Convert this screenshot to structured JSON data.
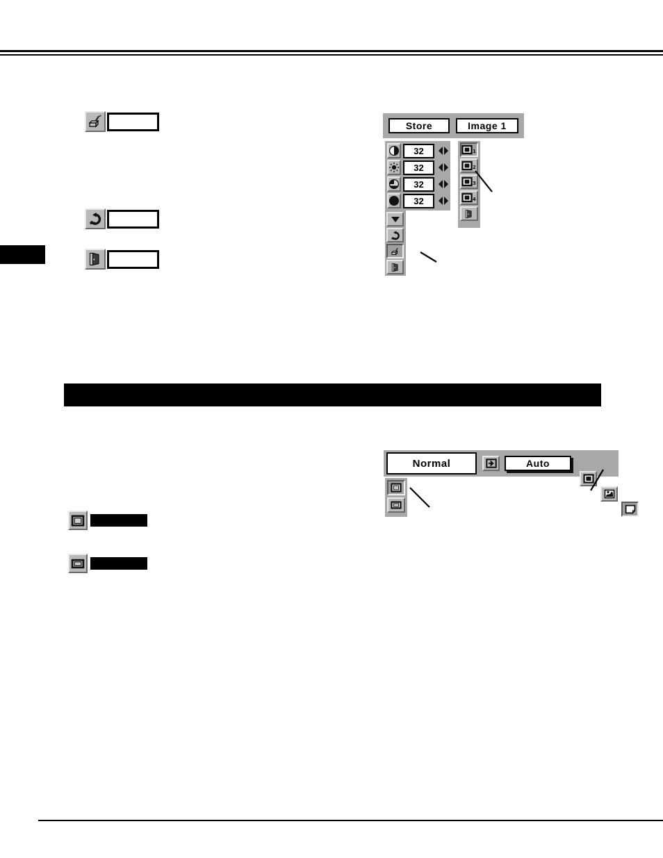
{
  "page": {
    "rules": {
      "header": "double-rule",
      "footer": "single-rule"
    },
    "side_tab": {
      "label": ""
    },
    "section_banner": {
      "label": ""
    }
  },
  "legend_left_top": {
    "items": [
      {
        "icon": "store-projector-icon",
        "label": ""
      }
    ]
  },
  "legend_left_mid": {
    "items": [
      {
        "icon": "reset-undo-icon",
        "label": ""
      },
      {
        "icon": "quit-door-icon",
        "label": ""
      }
    ]
  },
  "legend_left_bottom": {
    "items": [
      {
        "icon": "screen-normal-icon",
        "label": ""
      },
      {
        "icon": "screen-wide-icon",
        "label": ""
      }
    ]
  },
  "image_adjust_menu": {
    "header": {
      "store_button": "Store",
      "image_select_button": "Image 1"
    },
    "adjustments": [
      {
        "icon": "contrast-icon",
        "value": "32",
        "arrows": "left-right-adjust-icon"
      },
      {
        "icon": "brightness-icon",
        "value": "32",
        "arrows": "left-right-adjust-icon"
      },
      {
        "icon": "color-icon",
        "value": "32",
        "arrows": "left-right-adjust-icon"
      },
      {
        "icon": "tint-icon",
        "value": "32",
        "arrows": "left-right-adjust-icon"
      }
    ],
    "tools": [
      {
        "icon": "scroll-down-arrow-icon",
        "name": "next-page"
      },
      {
        "icon": "reset-undo-icon",
        "name": "reset"
      },
      {
        "icon": "store-projector-icon",
        "name": "store",
        "selected": true
      },
      {
        "icon": "quit-door-icon",
        "name": "quit"
      }
    ],
    "image_levels": [
      {
        "icon": "image-1-icon",
        "label": "1",
        "selected": true
      },
      {
        "icon": "image-2-icon",
        "label": "2",
        "selected": false
      },
      {
        "icon": "image-3-icon",
        "label": "3",
        "selected": false
      },
      {
        "icon": "image-4-icon",
        "label": "4",
        "selected": false
      },
      {
        "icon": "quit-door-icon",
        "label": "",
        "selected": false
      }
    ],
    "callouts": [
      {
        "name": "image-level-callout",
        "target": "image-2-icon"
      },
      {
        "name": "store-tool-callout",
        "target": "store-projector-icon"
      }
    ]
  },
  "screen_menu": {
    "current_mode": "Normal",
    "input_icon": "input-source-icon",
    "auto_button": "Auto",
    "items": [
      {
        "icon": "screen-normal-icon",
        "name": "normal"
      },
      {
        "icon": "screen-true-icon",
        "name": "true"
      },
      {
        "icon": "screen-wide-icon",
        "name": "wide",
        "selected": true
      }
    ],
    "callouts": [
      {
        "name": "screen-size-callout",
        "target": "screen-wide-icon"
      },
      {
        "name": "screen-mode-callout",
        "target": "screen-normal-icon"
      }
    ]
  }
}
